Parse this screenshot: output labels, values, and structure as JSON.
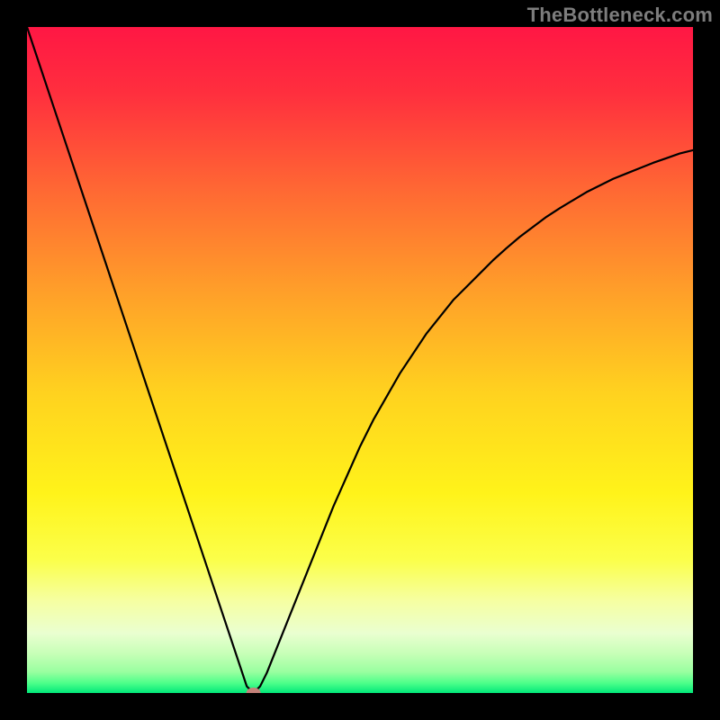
{
  "watermark": "TheBottleneck.com",
  "chart_data": {
    "type": "line",
    "title": "",
    "xlabel": "",
    "ylabel": "",
    "xlim": [
      0,
      100
    ],
    "ylim": [
      0,
      100
    ],
    "x": [
      0,
      2,
      4,
      6,
      8,
      10,
      12,
      14,
      16,
      18,
      20,
      22,
      24,
      26,
      28,
      30,
      32,
      33,
      34,
      35,
      36,
      38,
      40,
      42,
      44,
      46,
      48,
      50,
      52,
      54,
      56,
      58,
      60,
      62,
      64,
      66,
      68,
      70,
      72,
      74,
      76,
      78,
      80,
      82,
      84,
      86,
      88,
      90,
      92,
      94,
      96,
      98,
      100
    ],
    "y": [
      100,
      94,
      88,
      82,
      76,
      70,
      64,
      58,
      52,
      46,
      40,
      34,
      28,
      22,
      16,
      10,
      4,
      1,
      0,
      1,
      3,
      8,
      13,
      18,
      23,
      28,
      32.5,
      37,
      41,
      44.5,
      48,
      51,
      54,
      56.5,
      59,
      61,
      63,
      65,
      66.8,
      68.5,
      70,
      71.5,
      72.8,
      74,
      75.2,
      76.2,
      77.2,
      78,
      78.8,
      79.6,
      80.3,
      81,
      81.5
    ],
    "vertex": {
      "x": 34,
      "y": 0
    },
    "marker": {
      "x": 34,
      "y": 0,
      "color": "#c48179"
    },
    "background_gradient": {
      "stops": [
        {
          "offset": 0.0,
          "color": "#ff1744"
        },
        {
          "offset": 0.1,
          "color": "#ff2f3e"
        },
        {
          "offset": 0.25,
          "color": "#ff6a33"
        },
        {
          "offset": 0.4,
          "color": "#ffa029"
        },
        {
          "offset": 0.55,
          "color": "#ffd21f"
        },
        {
          "offset": 0.7,
          "color": "#fff31a"
        },
        {
          "offset": 0.8,
          "color": "#fbff4a"
        },
        {
          "offset": 0.86,
          "color": "#f6ffa0"
        },
        {
          "offset": 0.91,
          "color": "#eaffd0"
        },
        {
          "offset": 0.94,
          "color": "#c8ffb8"
        },
        {
          "offset": 0.968,
          "color": "#9affa0"
        },
        {
          "offset": 0.985,
          "color": "#4eff8a"
        },
        {
          "offset": 1.0,
          "color": "#00e879"
        }
      ]
    }
  }
}
